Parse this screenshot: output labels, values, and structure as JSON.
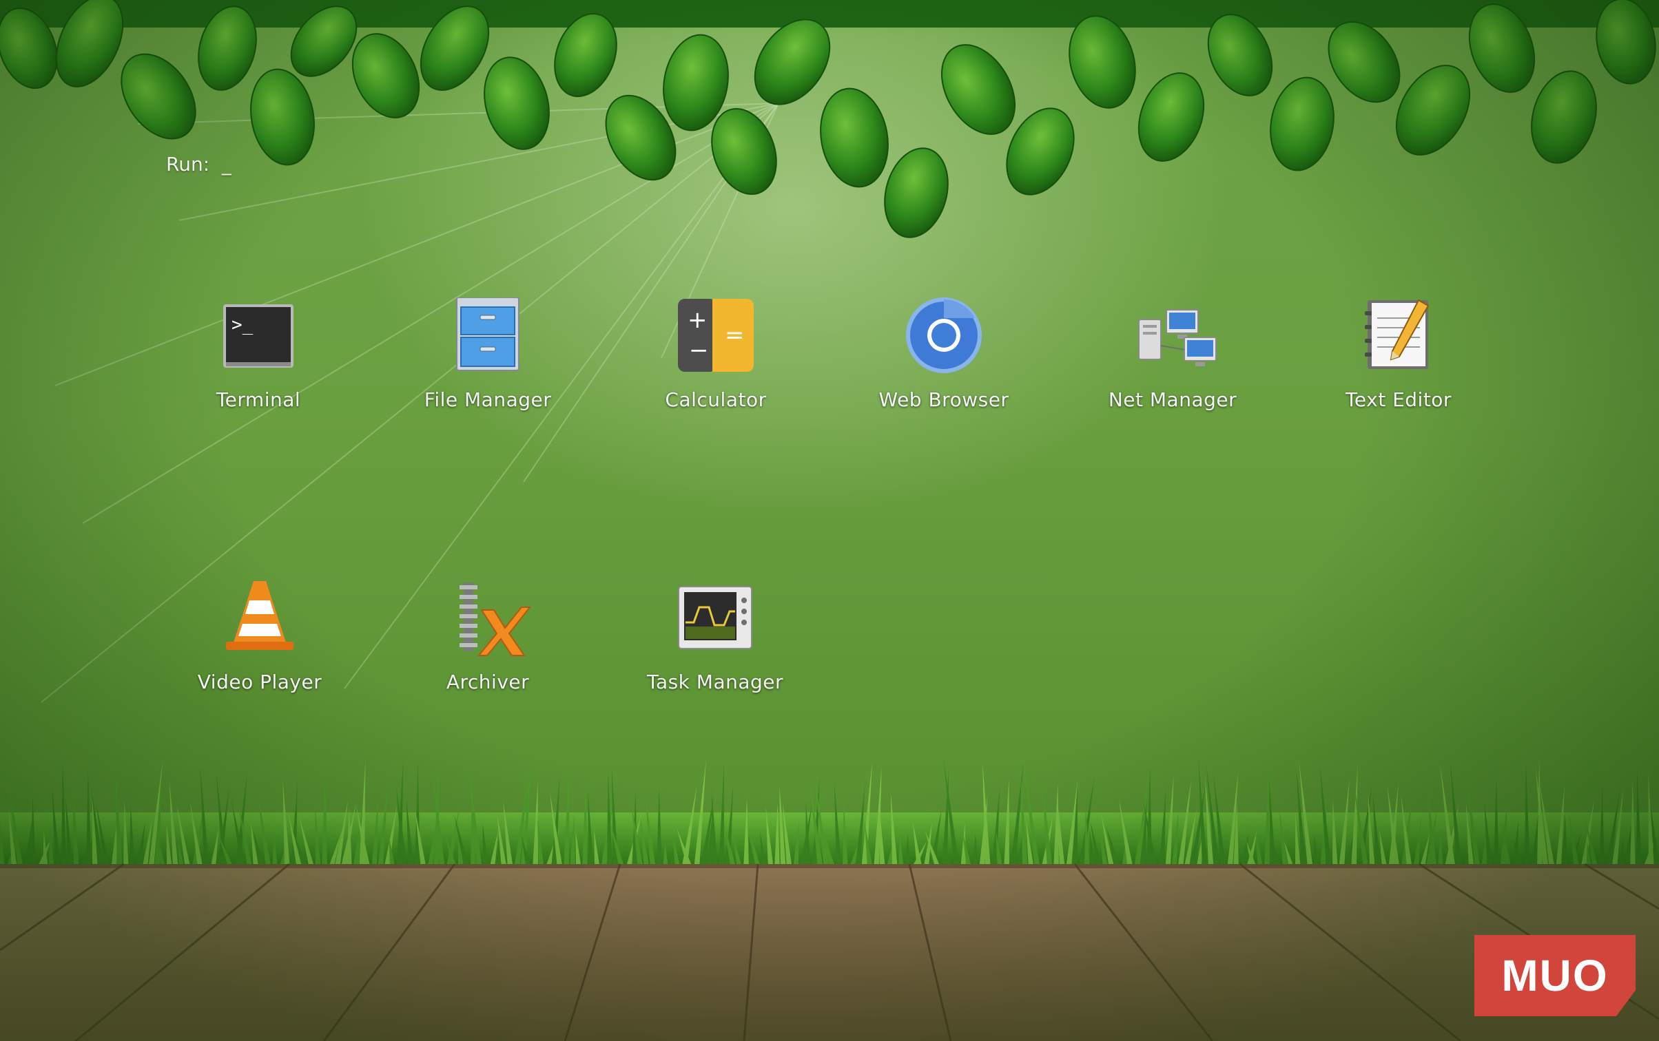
{
  "desktop": {
    "run_prompt": "Run:  _",
    "launchers": [
      {
        "id": "terminal",
        "label": "Terminal",
        "icon": "terminal-icon"
      },
      {
        "id": "file-manager",
        "label": "File Manager",
        "icon": "file-cabinet-icon"
      },
      {
        "id": "calculator",
        "label": "Calculator",
        "icon": "calculator-icon"
      },
      {
        "id": "web-browser",
        "label": "Web Browser",
        "icon": "chromium-icon"
      },
      {
        "id": "net-manager",
        "label": "Net Manager",
        "icon": "network-computers-icon"
      },
      {
        "id": "text-editor",
        "label": "Text Editor",
        "icon": "notepad-pencil-icon"
      },
      {
        "id": "video-player",
        "label": "Video Player",
        "icon": "traffic-cone-icon"
      },
      {
        "id": "archiver",
        "label": "Archiver",
        "icon": "zipper-archive-icon"
      },
      {
        "id": "task-manager",
        "label": "Task Manager",
        "icon": "system-monitor-icon"
      }
    ]
  },
  "watermark": {
    "text": "MUO",
    "color": "#d2453a"
  }
}
